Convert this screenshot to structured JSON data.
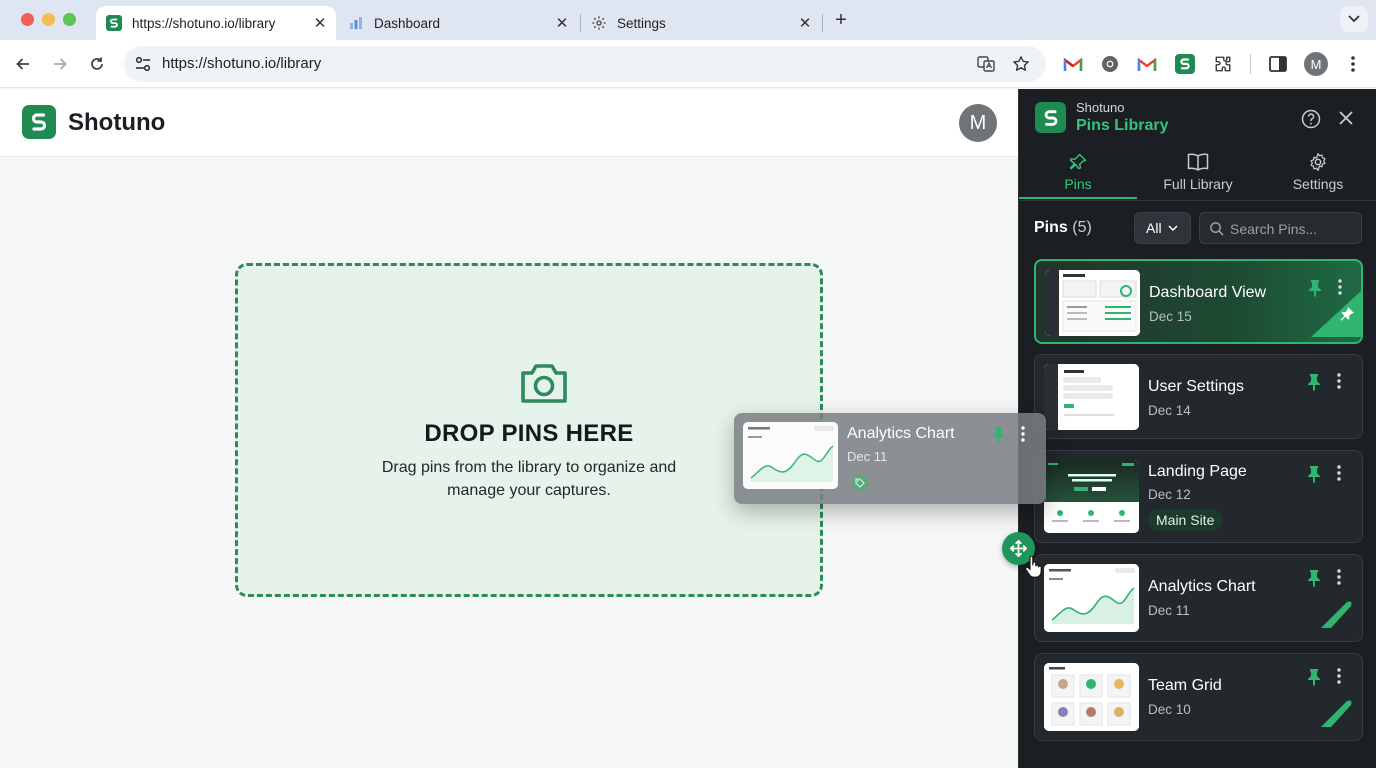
{
  "browser": {
    "tabs": [
      {
        "title": "https://shotuno.io/library",
        "active": true
      },
      {
        "title": "Dashboard",
        "active": false
      },
      {
        "title": "Settings",
        "active": false
      }
    ],
    "url": "https://shotuno.io/library",
    "profile_initial": "M"
  },
  "app": {
    "brand": "Shotuno",
    "avatar_initial": "M",
    "accent": "#1f8a52"
  },
  "dropzone": {
    "title": "DROP PINS HERE",
    "description": "Drag pins from the library to organize and manage your captures."
  },
  "dragging": {
    "title": "Analytics Chart",
    "date": "Dec 11"
  },
  "panel": {
    "app_name": "Shotuno",
    "title": "Pins Library",
    "tabs": [
      {
        "label": "Pins",
        "icon": "pin-icon",
        "active": true
      },
      {
        "label": "Full Library",
        "icon": "book-icon",
        "active": false
      },
      {
        "label": "Settings",
        "icon": "gear-icon",
        "active": false
      }
    ],
    "pins_label": "Pins",
    "pins_count": "(5)",
    "filter_value": "All",
    "search_placeholder": "Search Pins...",
    "pins": [
      {
        "title": "Dashboard View",
        "date": "Dec 15",
        "selected": true
      },
      {
        "title": "User Settings",
        "date": "Dec 14"
      },
      {
        "title": "Landing Page",
        "date": "Dec 12",
        "tag": "Main Site"
      },
      {
        "title": "Analytics Chart",
        "date": "Dec 11"
      },
      {
        "title": "Team Grid",
        "date": "Dec 10"
      }
    ]
  }
}
